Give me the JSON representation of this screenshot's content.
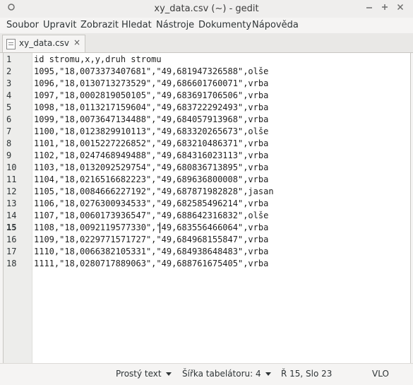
{
  "window": {
    "title": "xy_data.csv (~) - gedit",
    "icons": {
      "menu": "circle-icon",
      "minimize": "minimize-icon",
      "maximize": "maximize-icon",
      "close": "close-icon"
    }
  },
  "menubar": {
    "items": [
      "Soubor",
      "Upravit",
      "Zobrazit",
      "Hledat",
      "Nástroje",
      "Dokumenty",
      "Nápověda"
    ]
  },
  "tab": {
    "label": "xy_data.csv",
    "close_glyph": "×"
  },
  "editor": {
    "current_line": 15,
    "line_numbers": [
      "1",
      "2",
      "3",
      "4",
      "5",
      "6",
      "7",
      "8",
      "9",
      "10",
      "11",
      "12",
      "13",
      "14",
      "15",
      "16",
      "17",
      "18"
    ],
    "lines": [
      "id stromu,x,y,druh stromu",
      "1095,\"18,0073373407681\",\"49,681947326588\",olše",
      "1096,\"18,0130713273529\",\"49,686601760071\",vrba",
      "1097,\"18,0002819050105\",\"49,683691706506\",vrba",
      "1098,\"18,0113217159604\",\"49,683722292493\",vrba",
      "1099,\"18,0073647134488\",\"49,684057913968\",vrba",
      "1100,\"18,0123829910113\",\"49,683320265673\",olše",
      "1101,\"18,0015227226852\",\"49,683210486371\",vrba",
      "1102,\"18,0247468949488\",\"49,684316023113\",vrba",
      "1103,\"18,0132092529754\",\"49,680836713895\",vrba",
      "1104,\"18,0216516682223\",\"49,689636800008\",vrba",
      "1105,\"18,0084666227192\",\"49,687871982828\",jasan",
      "1106,\"18,0276300934533\",\"49,682585496214\",vrba",
      "1107,\"18,0060173936547\",\"49,688642316832\",olše",
      "1108,\"18,0092119577330\",\"49,683556466064\",vrba",
      "1109,\"18,0229771571727\",\"49,684968155847\",vrba",
      "1110,\"18,0066382105331\",\"49,684938648483\",vrba",
      "1111,\"18,0280717889063\",\"49,688761675405\",vrba"
    ]
  },
  "statusbar": {
    "language": "Prostý text",
    "tab_width": "Šířka tabelátoru: 4",
    "position": "Ř 15, Slo 23",
    "insert_mode": "VLO"
  }
}
